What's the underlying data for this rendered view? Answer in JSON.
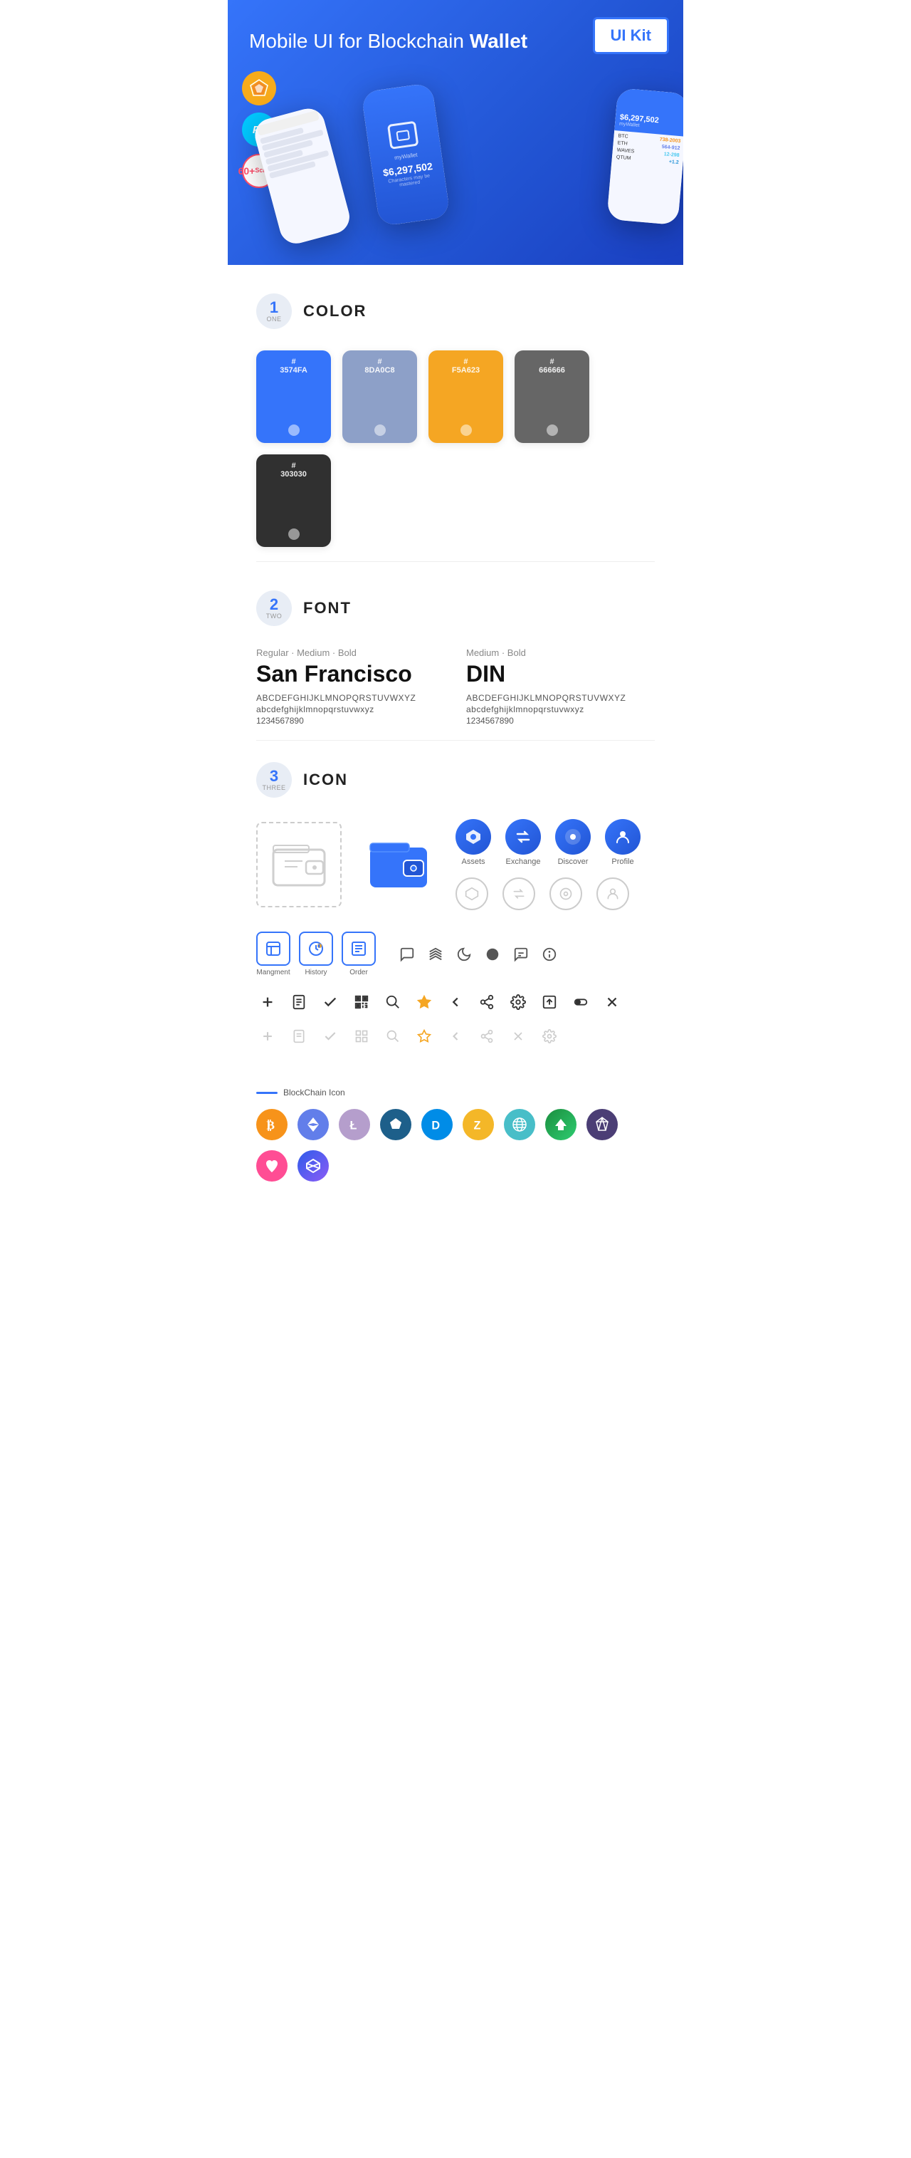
{
  "hero": {
    "title_regular": "Mobile UI for Blockchain ",
    "title_bold": "Wallet",
    "badge": "UI Kit",
    "badges": [
      {
        "id": "sketch",
        "label": "S",
        "type": "sketch"
      },
      {
        "id": "ps",
        "label": "Ps",
        "type": "ps"
      },
      {
        "id": "screens",
        "line1": "60+",
        "line2": "Screens",
        "type": "screens"
      }
    ]
  },
  "sections": {
    "color": {
      "number": "1",
      "word": "ONE",
      "title": "COLOR",
      "swatches": [
        {
          "hex": "#3574FA",
          "label": "3574FA",
          "bg": "#3574FA"
        },
        {
          "hex": "#8DA0C8",
          "label": "8DA0C8",
          "bg": "#8DA0C8"
        },
        {
          "hex": "#F5A623",
          "label": "F5A623",
          "bg": "#F5A623"
        },
        {
          "hex": "#666666",
          "label": "666666",
          "bg": "#666666"
        },
        {
          "hex": "#303030",
          "label": "303030",
          "bg": "#303030"
        }
      ]
    },
    "font": {
      "number": "2",
      "word": "TWO",
      "title": "FONT",
      "fonts": [
        {
          "label": "Regular · Medium · Bold",
          "name": "San Francisco",
          "uppercase": "ABCDEFGHIJKLMNOPQRSTUVWXYZ",
          "lowercase": "abcdefghijklmnopqrstuvwxyz",
          "numbers": "1234567890"
        },
        {
          "label": "Medium · Bold",
          "name": "DIN",
          "uppercase": "ABCDEFGHIJKLMNOPQRSTUVWXYZ",
          "lowercase": "abcdefghijklmnopqrstuvwxyz",
          "numbers": "1234567890"
        }
      ]
    },
    "icon": {
      "number": "3",
      "word": "THREE",
      "title": "ICON",
      "colored_icons": [
        {
          "label": "Assets",
          "color": "#3574FA"
        },
        {
          "label": "Exchange",
          "color": "#3574FA"
        },
        {
          "label": "Discover",
          "color": "#3574FA"
        },
        {
          "label": "Profile",
          "color": "#3574FA"
        }
      ],
      "tab_icons": [
        {
          "label": "Mangment"
        },
        {
          "label": "History"
        },
        {
          "label": "Order"
        }
      ],
      "blockchain_label": "BlockChain Icon",
      "crypto_coins": [
        {
          "symbol": "₿",
          "color": "#F7931A",
          "bg": "#FFF3E0"
        },
        {
          "symbol": "Ξ",
          "color": "#627EEA",
          "bg": "#E8EDFF"
        },
        {
          "symbol": "Ł",
          "color": "#B59ECC",
          "bg": "#F0EBF8"
        },
        {
          "symbol": "◆",
          "color": "#1D5F8A",
          "bg": "#E0EEF5"
        },
        {
          "symbol": "D",
          "color": "#008CE7",
          "bg": "#E0F2FF"
        },
        {
          "symbol": "Z",
          "color": "#F4B728",
          "bg": "#FFF8E0"
        },
        {
          "symbol": "◈",
          "color": "#48BEC8",
          "bg": "#E0F8FA"
        },
        {
          "symbol": "▲",
          "color": "#1B8E3E",
          "bg": "#E0F5E8"
        },
        {
          "symbol": "◇",
          "color": "#4B3E75",
          "bg": "#EDEAF5"
        },
        {
          "symbol": "∞",
          "color": "#FF4D94",
          "bg": "#FFE0F0"
        },
        {
          "symbol": "~",
          "color": "#2E5CEA",
          "bg": "#E0E8FF"
        }
      ]
    }
  }
}
